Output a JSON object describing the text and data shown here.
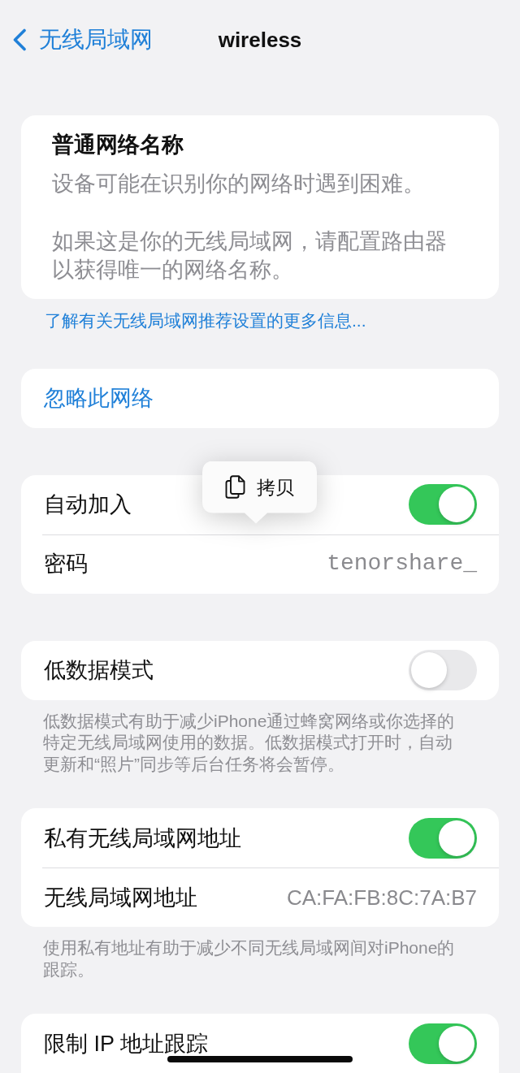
{
  "nav": {
    "back_label": "无线局域网",
    "title": "wireless"
  },
  "notice": {
    "title": "普通网络名称",
    "paragraphs": [
      "设备可能在识别你的网络时遇到困难。",
      "如果这是你的无线局域网，请配置路由器以获得唯一的网络名称。"
    ]
  },
  "notice_link": "了解有关无线局域网推荐设置的更多信息...",
  "groups": [
    {
      "rows": [
        {
          "kind": "action",
          "label": "忽略此网络"
        }
      ]
    },
    {
      "rows": [
        {
          "kind": "toggle",
          "label": "自动加入",
          "on": true
        },
        {
          "kind": "password",
          "label": "密码",
          "value": "tenorshare_"
        }
      ],
      "callout": {
        "label": "拷贝"
      }
    },
    {
      "rows": [
        {
          "kind": "toggle",
          "label": "低数据模式",
          "on": false
        }
      ],
      "footer": "低数据模式有助于减少iPhone通过蜂窝网络或你选择的特定无线局域网使用的数据。低数据模式打开时，自动更新和“照片”同步等后台任务将会暂停。"
    },
    {
      "rows": [
        {
          "kind": "toggle",
          "label": "私有无线局域网地址",
          "on": true
        },
        {
          "kind": "value",
          "label": "无线局域网地址",
          "value": "CA:FA:FB:8C:7A:B7"
        }
      ],
      "footer": "使用私有地址有助于减少不同无线局域网间对iPhone的跟踪。"
    },
    {
      "rows": [
        {
          "kind": "toggle",
          "label": "限制 IP 地址跟踪",
          "on": true
        }
      ]
    }
  ]
}
